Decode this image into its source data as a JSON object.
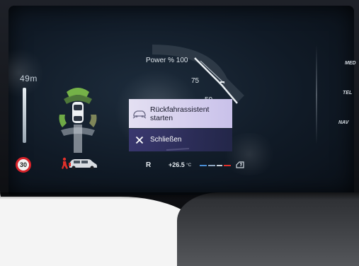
{
  "cluster": {
    "parking_distance": "49m",
    "speed_limit": "30",
    "power_label": "Power %",
    "power_ticks": [
      "100",
      "75",
      "50"
    ],
    "gear": "R",
    "temperature": "+26.5",
    "temperature_unit": "°C",
    "side_menu": [
      "MED",
      "TEL",
      "NAV"
    ]
  },
  "menu": {
    "items": [
      {
        "label": "Rückfahrassistent starten",
        "icon": "reverse-assist-icon",
        "selected": true
      },
      {
        "label": "Schließen",
        "icon": "close-icon",
        "selected": false
      }
    ]
  },
  "colors": {
    "menu_selected": "#c9c1ea",
    "menu_normal": "#3e3a78",
    "speed_sign_border": "#d8232a",
    "warning_red": "#e0302a",
    "parking_green": "#7fc24a"
  }
}
